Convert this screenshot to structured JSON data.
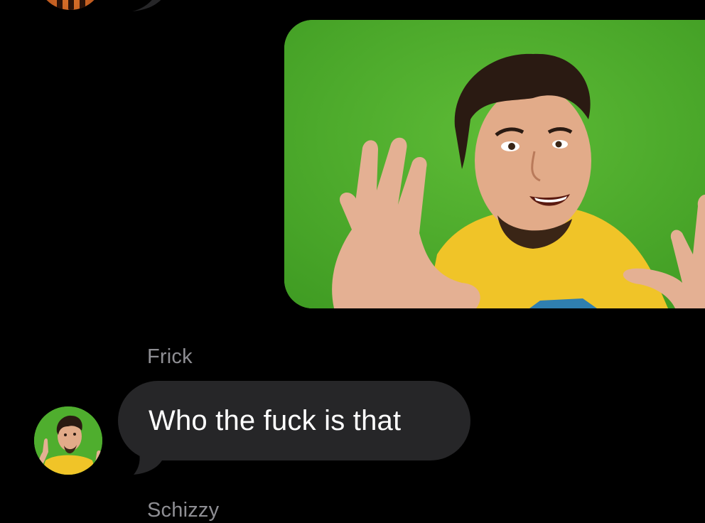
{
  "conversation": {
    "previous": {
      "avatar_icon": "contact-avatar-icon"
    },
    "outgoing_image": {
      "icon": "photo-attachment-icon",
      "background_color": "#4fae2e"
    },
    "messages": [
      {
        "sender": "Frick",
        "text": "Who the fuck is that",
        "avatar_icon": "contact-avatar-icon"
      }
    ],
    "next_sender": "Schizzy"
  },
  "colors": {
    "background": "#000000",
    "incoming_bubble": "#262628",
    "sender_label": "#8e8e93",
    "message_text": "#ffffff"
  }
}
